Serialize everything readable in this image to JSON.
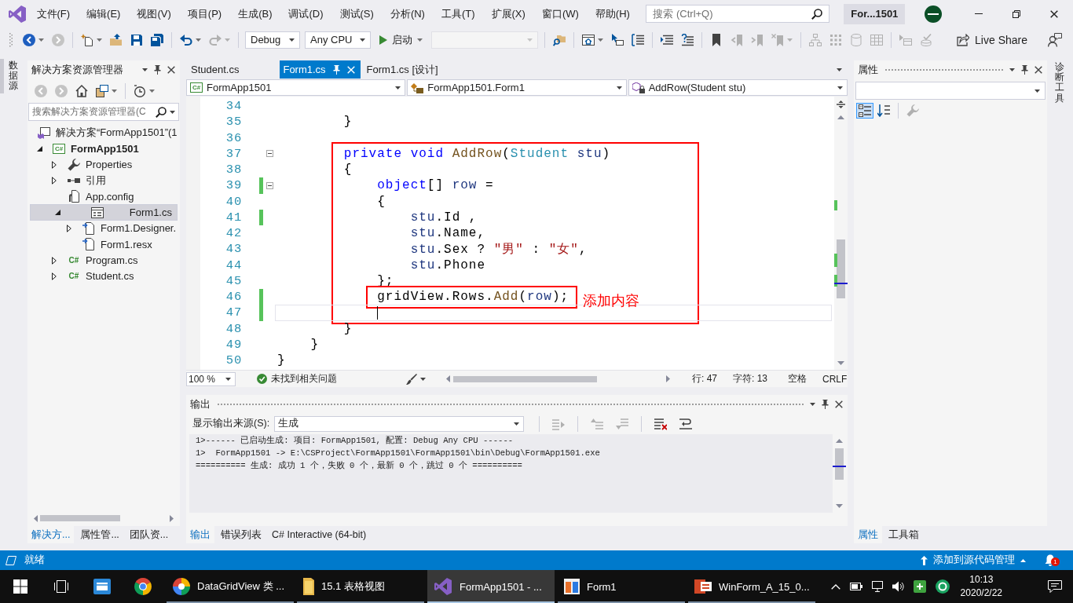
{
  "menu_bar": {
    "items": [
      "文件(F)",
      "编辑(E)",
      "视图(V)",
      "项目(P)",
      "生成(B)",
      "调试(D)",
      "测试(S)",
      "分析(N)",
      "工具(T)",
      "扩展(X)",
      "窗口(W)",
      "帮助(H)"
    ],
    "search": {
      "placeholder": "搜索 (Ctrl+Q)"
    },
    "title_badge": "For...1501"
  },
  "toolbar": {
    "groups": [
      [
        {
          "kind": "back",
          "disabled": false
        },
        {
          "kind": "forward",
          "disabled": true
        }
      ],
      [
        {
          "kind": "new-item",
          "disabled": false
        },
        {
          "kind": "open",
          "disabled": false
        },
        {
          "kind": "save",
          "disabled": false
        },
        {
          "kind": "save-all",
          "disabled": false
        }
      ],
      [
        {
          "kind": "undo",
          "disabled": false
        },
        {
          "kind": "redo",
          "disabled": true
        }
      ],
      [
        {
          "kind": "select",
          "value": "Debug",
          "disabled": false
        },
        {
          "kind": "select",
          "value": "Any CPU",
          "disabled": false
        },
        {
          "kind": "start",
          "label": "启动",
          "disabled": false
        },
        {
          "kind": "select",
          "disabled": true
        }
      ],
      [
        {
          "kind": "find-in-files",
          "disabled": false
        }
      ],
      [
        {
          "kind": "web-page",
          "disabled": false
        },
        {
          "kind": "pointer",
          "disabled": false
        },
        {
          "kind": "indent",
          "disabled": false
        }
      ],
      [
        {
          "kind": "format",
          "disabled": false
        },
        {
          "kind": "comment",
          "disabled": false
        }
      ],
      [
        {
          "kind": "bookmark",
          "disabled": false
        },
        {
          "kind": "bookmark-prev",
          "disabled": true
        },
        {
          "kind": "bookmark-next",
          "disabled": true
        },
        {
          "kind": "bookmark-clear",
          "disabled": true
        }
      ],
      [
        {
          "kind": "diagram",
          "disabled": true
        },
        {
          "kind": "grid",
          "disabled": true
        },
        {
          "kind": "query",
          "disabled": true
        },
        {
          "kind": "table",
          "disabled": true
        }
      ],
      [
        {
          "kind": "query-window",
          "disabled": true
        },
        {
          "kind": "query-check",
          "disabled": true
        }
      ]
    ],
    "live_share": "Live Share"
  },
  "left_strip": {
    "tabs": [
      "数据源"
    ]
  },
  "solution_explorer": {
    "title": "解决方案资源管理器",
    "toolbar": [
      {
        "kind": "back",
        "disabled": true
      },
      {
        "kind": "forward",
        "disabled": true
      },
      {
        "kind": "home",
        "disabled": false
      },
      {
        "kind": "views",
        "disabled": false
      },
      {
        "kind": "history",
        "disabled": false
      }
    ],
    "search": {
      "placeholder": "搜索解决方案资源管理器(C"
    },
    "tree": [
      {
        "kind": "solution",
        "label": "解决方案“FormApp1501”(1",
        "selected": false,
        "children": [
          {
            "kind": "project",
            "glyph": "C#",
            "label": "FormApp1501",
            "expanded": true,
            "selected": false,
            "children": [
              {
                "kind": "properties",
                "label": "Properties",
                "expanded": false,
                "selected": false
              },
              {
                "kind": "references",
                "label": "引用",
                "expanded": false,
                "selected": false
              },
              {
                "kind": "config",
                "label": "App.config",
                "selected": false
              },
              {
                "kind": "form",
                "label": "Form1.cs",
                "expanded": true,
                "selected": true,
                "children": [
                  {
                    "kind": "file",
                    "label": "Form1.Designer.",
                    "expanded": false,
                    "selected": false
                  },
                  {
                    "kind": "file",
                    "label": "Form1.resx",
                    "selected": false
                  }
                ]
              },
              {
                "kind": "csharp",
                "glyph": "C#",
                "label": "Program.cs",
                "expanded": false,
                "selected": false
              },
              {
                "kind": "csharp",
                "glyph": "C#",
                "label": "Student.cs",
                "expanded": false,
                "selected": false
              }
            ]
          }
        ]
      }
    ],
    "tabs": [
      {
        "label": "解决方...",
        "selected": true
      },
      {
        "label": "属性管...",
        "selected": false
      },
      {
        "label": "团队资...",
        "selected": false
      }
    ]
  },
  "editor": {
    "tabs": [
      {
        "label": "Student.cs",
        "selected": false
      },
      {
        "label": "Form1.cs",
        "selected": true
      },
      {
        "label": "Form1.cs [设计]",
        "selected": false
      }
    ],
    "nav": [
      {
        "kind": "project",
        "glyph": "C#",
        "label": "FormApp1501"
      },
      {
        "kind": "class",
        "label": "FormApp1501.Form1"
      },
      {
        "kind": "method",
        "label": "AddRow(Student stu)"
      }
    ],
    "lines": [
      {
        "number": "34",
        "changed": false,
        "collapsible": false,
        "current": false
      },
      {
        "number": "35",
        "tokens": [
          {
            "text": "        }",
            "kind": "plain"
          }
        ],
        "changed": false,
        "collapsible": false,
        "current": false
      },
      {
        "number": "36",
        "changed": false,
        "collapsible": false,
        "current": false
      },
      {
        "number": "37",
        "tokens": [
          {
            "text": "        private void",
            "kind": "keyword"
          },
          {
            "text": " AddRow",
            "kind": "method"
          },
          {
            "text": "(",
            "kind": "plain"
          },
          {
            "text": "Student",
            "kind": "type"
          },
          {
            "text": " stu",
            "kind": "param"
          },
          {
            "text": ")",
            "kind": "plain"
          }
        ],
        "changed": false,
        "collapsible": true,
        "current": false
      },
      {
        "number": "38",
        "tokens": [
          {
            "text": "        {",
            "kind": "plain"
          }
        ],
        "changed": false,
        "collapsible": false,
        "current": false
      },
      {
        "number": "39",
        "tokens": [
          {
            "text": "            object",
            "kind": "keyword"
          },
          {
            "text": "[] ",
            "kind": "plain"
          },
          {
            "text": "row",
            "kind": "param"
          },
          {
            "text": " =",
            "kind": "plain"
          }
        ],
        "changed": true,
        "collapsible": true,
        "current": false
      },
      {
        "number": "40",
        "tokens": [
          {
            "text": "            {",
            "kind": "plain"
          }
        ],
        "changed": false,
        "collapsible": false,
        "current": false
      },
      {
        "number": "41",
        "tokens": [
          {
            "text": "                stu",
            "kind": "param"
          },
          {
            "text": ".Id ,",
            "kind": "plain"
          }
        ],
        "changed": true,
        "collapsible": false,
        "current": false
      },
      {
        "number": "42",
        "tokens": [
          {
            "text": "                stu",
            "kind": "param"
          },
          {
            "text": ".Name,",
            "kind": "plain"
          }
        ],
        "changed": false,
        "collapsible": false,
        "current": false
      },
      {
        "number": "43",
        "tokens": [
          {
            "text": "                stu",
            "kind": "param"
          },
          {
            "text": ".Sex ? ",
            "kind": "plain"
          },
          {
            "text": "\"男\"",
            "kind": "string"
          },
          {
            "text": " : ",
            "kind": "plain"
          },
          {
            "text": "\"女\"",
            "kind": "string"
          },
          {
            "text": ",",
            "kind": "plain"
          }
        ],
        "changed": false,
        "collapsible": false,
        "current": false
      },
      {
        "number": "44",
        "tokens": [
          {
            "text": "                stu",
            "kind": "param"
          },
          {
            "text": ".Phone",
            "kind": "plain"
          }
        ],
        "changed": false,
        "collapsible": false,
        "current": false
      },
      {
        "number": "45",
        "tokens": [
          {
            "text": "            };",
            "kind": "plain"
          }
        ],
        "changed": false,
        "collapsible": false,
        "current": false
      },
      {
        "number": "46",
        "tokens": [
          {
            "text": "            gridView.Rows.",
            "kind": "plain"
          },
          {
            "text": "Add",
            "kind": "method"
          },
          {
            "text": "(",
            "kind": "plain"
          },
          {
            "text": "row",
            "kind": "param"
          },
          {
            "text": ");",
            "kind": "plain"
          }
        ],
        "changed": true,
        "collapsible": false,
        "current": false
      },
      {
        "number": "47",
        "changed": true,
        "collapsible": false,
        "current": true
      },
      {
        "number": "48",
        "tokens": [
          {
            "text": "        }",
            "kind": "plain"
          }
        ],
        "changed": false,
        "collapsible": false,
        "current": false
      },
      {
        "number": "49",
        "tokens": [
          {
            "text": "    }",
            "kind": "plain"
          }
        ],
        "changed": false,
        "collapsible": false,
        "current": false
      },
      {
        "number": "50",
        "tokens": [
          {
            "text": "}",
            "kind": "plain"
          }
        ],
        "changed": false,
        "collapsible": false,
        "current": false
      }
    ],
    "annotations": [
      {
        "kind": "frame"
      },
      {
        "kind": "frame"
      },
      {
        "kind": "note",
        "text": "添加内容"
      }
    ],
    "status": {
      "zoom": "100 %",
      "issues": "未找到相关问题",
      "line": "行: 47",
      "column": "字符: 13",
      "indentation": "空格",
      "line_ending": "CRLF"
    }
  },
  "output": {
    "title": "输出",
    "source_label": "显示输出来源(S):",
    "source": "生成",
    "toolbar": [
      [
        {
          "kind": "goto",
          "disabled": true
        }
      ],
      [
        {
          "kind": "prev-message",
          "disabled": true
        },
        {
          "kind": "next-message",
          "disabled": true
        }
      ],
      [
        {
          "kind": "clear-all",
          "disabled": false
        },
        {
          "kind": "word-wrap",
          "disabled": false
        }
      ]
    ],
    "lines": [
      "1>------ 已启动生成: 项目: FormApp1501, 配置: Debug Any CPU ------",
      "1>  FormApp1501 -> E:\\CSProject\\FormApp1501\\FormApp1501\\bin\\Debug\\FormApp1501.exe",
      "========== 生成: 成功 1 个，失败 0 个，最新 0 个，跳过 0 个 =========="
    ],
    "tabs": [
      {
        "label": "输出",
        "selected": true
      },
      {
        "label": "错误列表",
        "selected": false
      },
      {
        "label": "C# Interactive (64-bit)",
        "selected": false
      }
    ]
  },
  "properties": {
    "title": "属性",
    "view_buttons": [
      [
        {
          "kind": "categorized",
          "selected": true,
          "disabled": false
        },
        {
          "kind": "alphabetical",
          "selected": false,
          "disabled": false
        }
      ],
      [
        {
          "kind": "property-pages",
          "selected": false,
          "disabled": true
        }
      ]
    ],
    "tabs": [
      {
        "label": "属性",
        "selected": true
      },
      {
        "label": "工具箱",
        "selected": false
      }
    ]
  },
  "right_strip": {
    "tabs": [
      "诊断工具"
    ]
  },
  "status_bar": {
    "text": "就绪",
    "source_control": "添加到源代码管理",
    "notifications": "1"
  },
  "taskbar": {
    "apps": [
      {
        "kind": "browser",
        "label": "DataGridView 类 ...",
        "selected": false
      },
      {
        "kind": "folder",
        "label": "15.1 表格视图",
        "selected": false
      },
      {
        "kind": "ide",
        "label": "FormApp1501 - ...",
        "selected": true
      },
      {
        "kind": "form",
        "label": "Form1",
        "selected": false
      },
      {
        "kind": "slides",
        "label": "WinForm_A_15_0...",
        "selected": false
      }
    ],
    "time": "10:13",
    "date": "2020/2/22"
  }
}
